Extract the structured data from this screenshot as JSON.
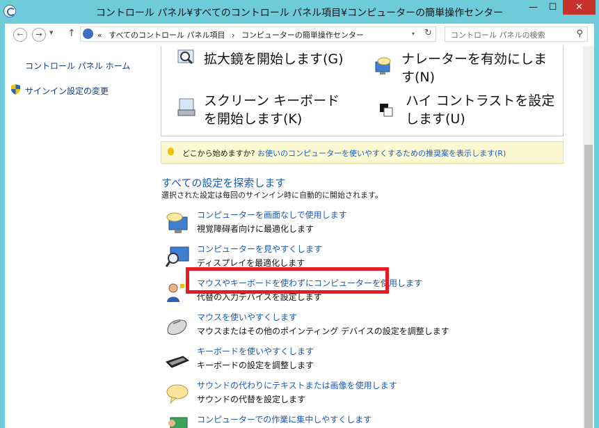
{
  "window": {
    "title": "コントロール パネル¥すべてのコントロール パネル項目¥コンピューターの簡単操作センター",
    "min_label": "—",
    "max_label": "☐",
    "close_label": "✕"
  },
  "nav": {
    "back": "←",
    "forward": "→",
    "dropdown": "▼",
    "up": "↑",
    "breadcrumb": [
      "«",
      "すべてのコントロール パネル項目",
      "›",
      "コンピューターの簡単操作センター"
    ],
    "address_dropdown": "▾",
    "refresh": "↻",
    "search_placeholder": "コントロール パネルの検索",
    "search_icon": "⚲"
  },
  "sidebar": {
    "home": "コントロール パネル ホーム",
    "signin": "サインイン設定の変更"
  },
  "quick_access": [
    {
      "icon": "magnifier-icon",
      "text": "拡大鏡を開始します(G)"
    },
    {
      "icon": "narrator-icon",
      "text": "ナレーターを有効にします(N)"
    },
    {
      "icon": "onscreen-keyboard-icon",
      "text": "スクリーン キーボードを開始します(K)"
    },
    {
      "icon": "high-contrast-icon",
      "text": "ハイ コントラストを設定します(U)"
    }
  ],
  "tip": {
    "prefix": "どこから始めますか?",
    "link": "お使いのコンピューターを使いやすくするための推奨案を表示します(R)"
  },
  "explore": {
    "heading": "すべての設定を探索します",
    "subtitle": "選択された設定は毎回のサインイン時に自動的に開始されます。"
  },
  "settings": [
    {
      "link": "コンピューターを画面なしで使用します",
      "desc": "視覚障碍者向けに最適化します",
      "icon": "monitor-speech-icon"
    },
    {
      "link": "コンピューターを見やすくします",
      "desc": "ディスプレイを最適化します",
      "icon": "monitor-magnifier-icon"
    },
    {
      "link": "マウスやキーボードを使わずにコンピューターを使用します",
      "desc": "代替の入力デバイスを設定します",
      "icon": "person-speech-icon"
    },
    {
      "link": "マウスを使いやすくします",
      "desc": "マウスまたはその他のポインティング デバイスの設定を調整します",
      "icon": "mouse-icon"
    },
    {
      "link": "キーボードを使いやすくします",
      "desc": "キーボードの設定を調整します",
      "icon": "keyboard-icon"
    },
    {
      "link": "サウンドの代わりにテキストまたは画像を使用します",
      "desc": "サウンドの代替を設定します",
      "icon": "speech-bubble-icon"
    },
    {
      "link": "コンピューターでの作業に集中しやすくします",
      "desc": "",
      "icon": "focus-icon"
    }
  ],
  "colors": {
    "frame": "#6ecbd9",
    "link": "#1c58b8",
    "highlight": "#e61b23",
    "close": "#c7302c"
  }
}
